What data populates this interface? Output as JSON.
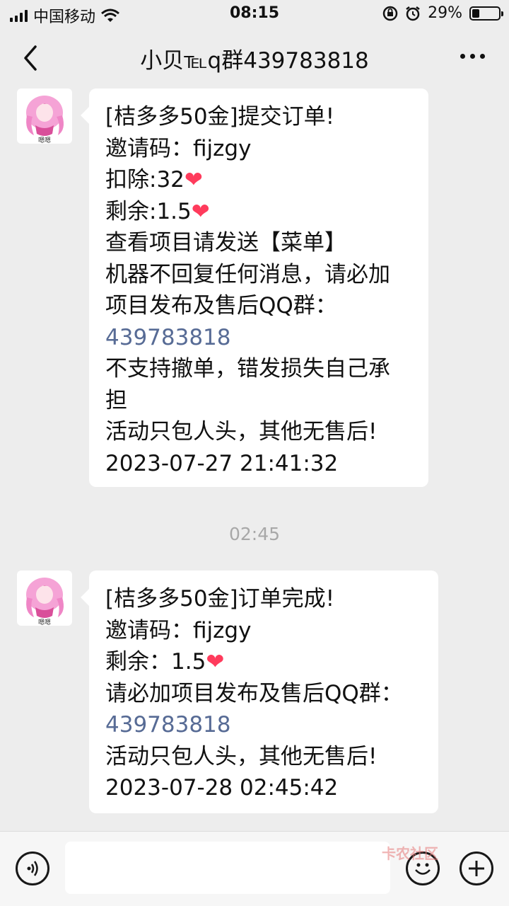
{
  "status_bar": {
    "carrier": "中国移动",
    "time": "08:15",
    "battery": "29%",
    "battery_level": 0.29
  },
  "header": {
    "title": "小贝℡q群439783818"
  },
  "messages": [
    {
      "lines": [
        "[桔多多50金]提交订单!",
        "邀请码：fijzgy",
        "扣除:32",
        "剩余:1.5",
        "查看项目请发送【菜单】",
        "机器不回复任何消息，请必加",
        "项目发布及售后QQ群：",
        "439783818",
        "不支持撤单，错发损失自己承",
        "担",
        "活动只包人头，其他无售后!",
        "2023-07-27 21:41:32"
      ]
    },
    {
      "lines": [
        "[桔多多50金]订单完成!",
        "邀请码：fijzgy",
        "剩余：1.5",
        "请必加项目发布及售后QQ群：",
        "439783818",
        "活动只包人头，其他无售后!",
        "2023-07-28 02:45:42"
      ]
    }
  ],
  "heart_glyph": "❤",
  "timestamp_divider": "02:45",
  "avatar_label": "嗯嗯",
  "watermark": "卡农社区",
  "colors": {
    "link": "#576b95",
    "heart": "#ff3b5c",
    "background": "#ededed"
  }
}
